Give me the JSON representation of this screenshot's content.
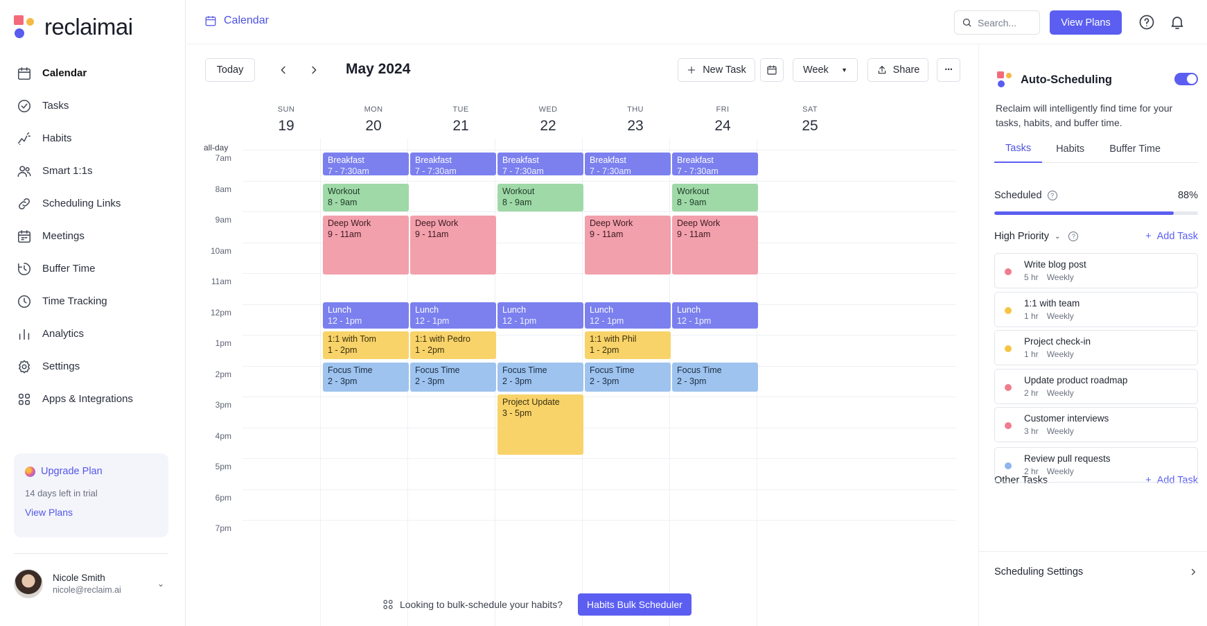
{
  "brand": {
    "name": "reclaimai"
  },
  "sidebar": {
    "items": [
      {
        "label": "Calendar",
        "icon": "calendar-icon",
        "active": true
      },
      {
        "label": "Tasks",
        "icon": "check-circle-icon"
      },
      {
        "label": "Habits",
        "icon": "habits-icon"
      },
      {
        "label": "Smart 1:1s",
        "icon": "users-icon"
      },
      {
        "label": "Scheduling Links",
        "icon": "link-icon"
      },
      {
        "label": "Meetings",
        "icon": "meetings-icon"
      },
      {
        "label": "Buffer Time",
        "icon": "buffer-icon"
      },
      {
        "label": "Time Tracking",
        "icon": "clock-icon"
      },
      {
        "label": "Analytics",
        "icon": "analytics-icon"
      },
      {
        "label": "Settings",
        "icon": "gear-icon"
      },
      {
        "label": "Apps & Integrations",
        "icon": "apps-icon"
      }
    ],
    "upgrade": {
      "title": "Upgrade Plan",
      "subtitle": "14 days left in trial",
      "link": "View Plans"
    },
    "user": {
      "name": "Nicole Smith",
      "email": "nicole@reclaim.ai"
    }
  },
  "header": {
    "breadcrumb": "Calendar",
    "search_placeholder": "Search...",
    "view_plans": "View Plans"
  },
  "toolbar": {
    "today": "Today",
    "month": "May 2024",
    "new_task": "New Task",
    "view": "Week",
    "share": "Share",
    "more": "···"
  },
  "calendar": {
    "allday_label": "all-day",
    "days": [
      {
        "name": "SUN",
        "num": "19"
      },
      {
        "name": "MON",
        "num": "20"
      },
      {
        "name": "TUE",
        "num": "21"
      },
      {
        "name": "WED",
        "num": "22"
      },
      {
        "name": "THU",
        "num": "23"
      },
      {
        "name": "FRI",
        "num": "24"
      },
      {
        "name": "SAT",
        "num": "25"
      }
    ],
    "hours": [
      "7am",
      "8am",
      "9am",
      "10am",
      "11am",
      "12pm",
      "1pm",
      "2pm",
      "3pm",
      "4pm",
      "5pm",
      "6pm",
      "7pm"
    ],
    "events": [
      {
        "day": 1,
        "title": "Breakfast",
        "time": "7 - 7:30am",
        "start": 7,
        "end": 7.75,
        "color": "purple"
      },
      {
        "day": 2,
        "title": "Breakfast",
        "time": "7 - 7:30am",
        "start": 7,
        "end": 7.75,
        "color": "purple"
      },
      {
        "day": 3,
        "title": "Breakfast",
        "time": "7 - 7:30am",
        "start": 7,
        "end": 7.75,
        "color": "purple"
      },
      {
        "day": 4,
        "title": "Breakfast",
        "time": "7 - 7:30am",
        "start": 7,
        "end": 7.75,
        "color": "purple"
      },
      {
        "day": 5,
        "title": "Breakfast",
        "time": "7 - 7:30am",
        "start": 7,
        "end": 7.75,
        "color": "purple"
      },
      {
        "day": 1,
        "title": "Workout",
        "time": "8 - 9am",
        "start": 8,
        "end": 8.9,
        "color": "green"
      },
      {
        "day": 3,
        "title": "Workout",
        "time": "8 - 9am",
        "start": 8,
        "end": 8.9,
        "color": "green"
      },
      {
        "day": 5,
        "title": "Workout",
        "time": "8 - 9am",
        "start": 8,
        "end": 8.9,
        "color": "green"
      },
      {
        "day": 1,
        "title": "Deep Work",
        "time": "9 - 11am",
        "start": 9.05,
        "end": 10.95,
        "color": "pink"
      },
      {
        "day": 2,
        "title": "Deep Work",
        "time": "9 - 11am",
        "start": 9.05,
        "end": 10.95,
        "color": "pink"
      },
      {
        "day": 4,
        "title": "Deep Work",
        "time": "9 - 11am",
        "start": 9.05,
        "end": 10.95,
        "color": "pink"
      },
      {
        "day": 5,
        "title": "Deep Work",
        "time": "9 - 11am",
        "start": 9.05,
        "end": 10.95,
        "color": "pink"
      },
      {
        "day": 1,
        "title": "Lunch",
        "time": "12 - 1pm",
        "start": 11.85,
        "end": 12.7,
        "color": "purple"
      },
      {
        "day": 2,
        "title": "Lunch",
        "time": "12 - 1pm",
        "start": 11.85,
        "end": 12.7,
        "color": "purple"
      },
      {
        "day": 3,
        "title": "Lunch",
        "time": "12 - 1pm",
        "start": 11.85,
        "end": 12.7,
        "color": "purple"
      },
      {
        "day": 4,
        "title": "Lunch",
        "time": "12 - 1pm",
        "start": 11.85,
        "end": 12.7,
        "color": "purple"
      },
      {
        "day": 5,
        "title": "Lunch",
        "time": "12 - 1pm",
        "start": 11.85,
        "end": 12.7,
        "color": "purple"
      },
      {
        "day": 1,
        "title": "1:1 with Tom",
        "time": "1 - 2pm",
        "start": 12.8,
        "end": 13.7,
        "color": "yellow"
      },
      {
        "day": 2,
        "title": "1:1 with Pedro",
        "time": "1 - 2pm",
        "start": 12.8,
        "end": 13.7,
        "color": "yellow"
      },
      {
        "day": 4,
        "title": "1:1 with Phil",
        "time": "1 - 2pm",
        "start": 12.8,
        "end": 13.7,
        "color": "yellow"
      },
      {
        "day": 1,
        "title": "Focus Time",
        "time": "2 - 3pm",
        "start": 13.8,
        "end": 14.75,
        "color": "blue"
      },
      {
        "day": 2,
        "title": "Focus Time",
        "time": "2 - 3pm",
        "start": 13.8,
        "end": 14.75,
        "color": "blue"
      },
      {
        "day": 3,
        "title": "Focus Time",
        "time": "2 - 3pm",
        "start": 13.8,
        "end": 14.75,
        "color": "blue"
      },
      {
        "day": 4,
        "title": "Focus Time",
        "time": "2 - 3pm",
        "start": 13.8,
        "end": 14.75,
        "color": "blue"
      },
      {
        "day": 5,
        "title": "Focus Time",
        "time": "2 - 3pm",
        "start": 13.8,
        "end": 14.75,
        "color": "blue"
      },
      {
        "day": 3,
        "title": "Project Update",
        "time": "3 - 5pm",
        "start": 14.85,
        "end": 16.8,
        "color": "yellow"
      }
    ],
    "bulk_text": "Looking to bulk-schedule your habits?",
    "bulk_button": "Habits Bulk Scheduler"
  },
  "panel": {
    "title": "Auto-Scheduling",
    "enabled": true,
    "description": "Reclaim will intelligently find time for your tasks, habits, and buffer time.",
    "tabs": [
      "Tasks",
      "Habits",
      "Buffer Time"
    ],
    "scheduled_label": "Scheduled",
    "scheduled_pct": "88%",
    "scheduled_value": 0.88,
    "high_priority_label": "High Priority",
    "add_task": "Add Task",
    "high_priority_tasks": [
      {
        "title": "Write blog post",
        "hours": "5 hr",
        "freq": "Weekly",
        "color": "#f07d8d"
      },
      {
        "title": "1:1 with team",
        "hours": "1 hr",
        "freq": "Weekly",
        "color": "#f6c445"
      },
      {
        "title": "Project check-in",
        "hours": "1 hr",
        "freq": "Weekly",
        "color": "#f6c445"
      },
      {
        "title": "Update product roadmap",
        "hours": "2 hr",
        "freq": "Weekly",
        "color": "#f07d8d"
      },
      {
        "title": "Customer interviews",
        "hours": "3 hr",
        "freq": "Weekly",
        "color": "#f07d8d"
      }
    ],
    "other_tasks_label": "Other Tasks",
    "other_tasks": [
      {
        "title": "Review pull requests",
        "hours": "2 hr",
        "freq": "Weekly",
        "color": "#8fb4ee"
      }
    ],
    "scheduling_settings": "Scheduling Settings"
  },
  "colors": {
    "accent": "#5b5ef0"
  }
}
